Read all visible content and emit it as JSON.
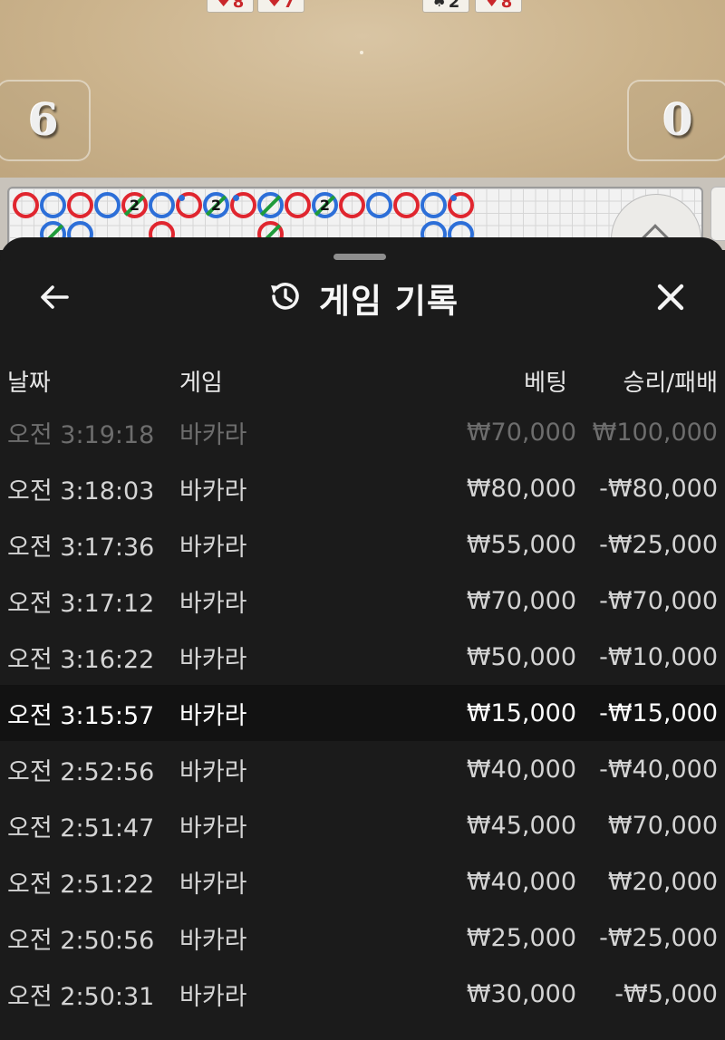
{
  "game_table": {
    "cards": [
      {
        "rank": "8",
        "suit": "heart"
      },
      {
        "rank": "7",
        "suit": "heart"
      },
      {
        "rank": "2",
        "suit": "spade"
      },
      {
        "rank": "8",
        "suit": "diamond"
      }
    ],
    "left_score": "6",
    "right_score": "0",
    "bead_road_badge": "2"
  },
  "sheet": {
    "title": "게임 기록",
    "icons": {
      "back": "arrow-left-icon",
      "history": "history-clock-icon",
      "close": "close-x-icon"
    },
    "columns": {
      "date": "날짜",
      "game": "게임",
      "bet": "베팅",
      "result": "승리/패배"
    },
    "rows": [
      {
        "date": "오전 3:19:18",
        "game": "바카라",
        "bet": "₩70,000",
        "result": "₩100,000"
      },
      {
        "date": "오전 3:18:03",
        "game": "바카라",
        "bet": "₩80,000",
        "result": "-₩80,000"
      },
      {
        "date": "오전 3:17:36",
        "game": "바카라",
        "bet": "₩55,000",
        "result": "-₩25,000"
      },
      {
        "date": "오전 3:17:12",
        "game": "바카라",
        "bet": "₩70,000",
        "result": "-₩70,000"
      },
      {
        "date": "오전 3:16:22",
        "game": "바카라",
        "bet": "₩50,000",
        "result": "-₩10,000"
      },
      {
        "date": "오전 3:15:57",
        "game": "바카라",
        "bet": "₩15,000",
        "result": "-₩15,000"
      },
      {
        "date": "오전 2:52:56",
        "game": "바카라",
        "bet": "₩40,000",
        "result": "-₩40,000"
      },
      {
        "date": "오전 2:51:47",
        "game": "바카라",
        "bet": "₩45,000",
        "result": "₩70,000"
      },
      {
        "date": "오전 2:51:22",
        "game": "바카라",
        "bet": "₩40,000",
        "result": "₩20,000"
      },
      {
        "date": "오전 2:50:56",
        "game": "바카라",
        "bet": "₩25,000",
        "result": "-₩25,000"
      },
      {
        "date": "오전 2:50:31",
        "game": "바카라",
        "bet": "₩30,000",
        "result": "-₩5,000"
      }
    ],
    "selected_row_index": 5,
    "faded_row_index": 0
  },
  "colors": {
    "sheet_bg": "#1b1b1b",
    "selected_row_bg": "#121212",
    "player_blue": "#2d6fd8",
    "banker_red": "#e0262f",
    "tie_green": "#1f9b3a"
  }
}
